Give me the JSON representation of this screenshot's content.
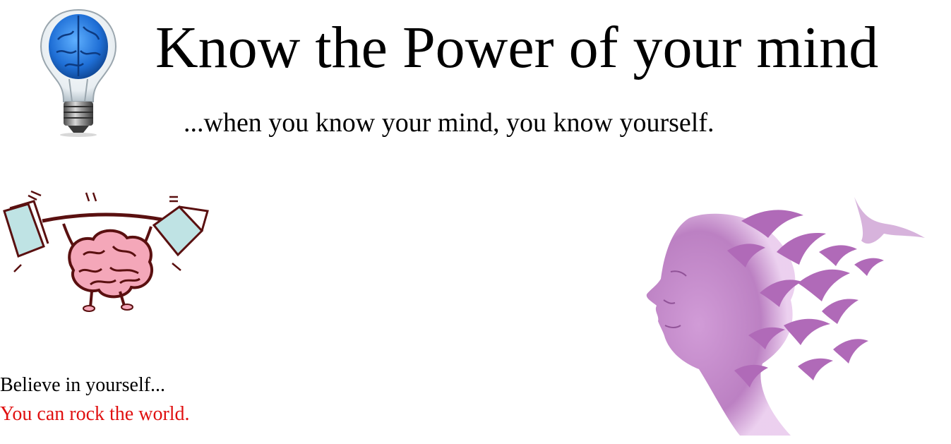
{
  "header": {
    "title": "Know the Power of your mind",
    "subtitle": "...when you know your mind, you know yourself."
  },
  "images": {
    "bulb": "brain-lightbulb-icon",
    "lifting": "brain-lifting-books-illustration",
    "face": "face-dissolving-into-birds-illustration"
  },
  "quotes": {
    "line1": "Believe in yourself...",
    "line2": "You can rock the world."
  },
  "colors": {
    "highlight": "#e01010",
    "bird_purple": "#b06ab8",
    "brain_pink": "#f4a7b9",
    "brain_blue": "#2a7de0"
  }
}
